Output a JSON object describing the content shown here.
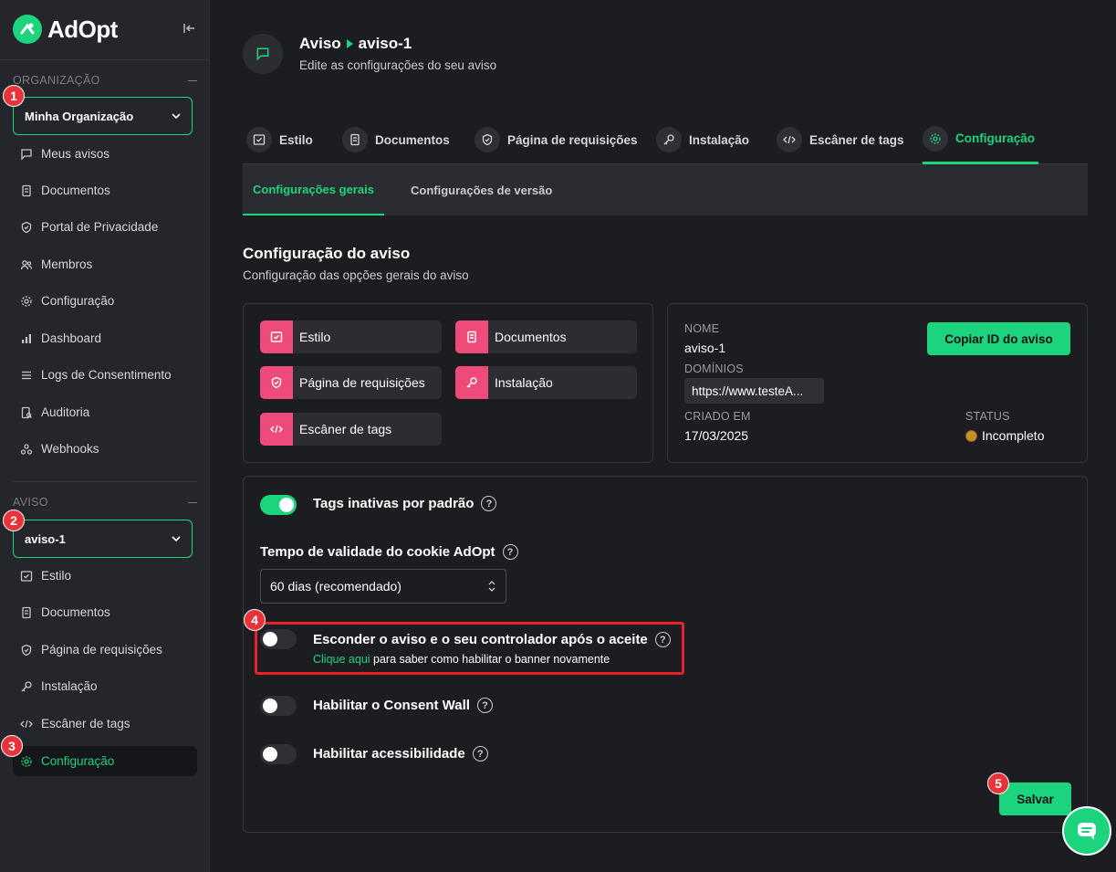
{
  "brand": {
    "name": "AdOpt",
    "color": "#1dd47e"
  },
  "sidebar": {
    "org_section": "ORGANIZAÇÃO",
    "org_select": "Minha Organização",
    "org_items": [
      {
        "label": "Meus avisos",
        "icon": "message-icon"
      },
      {
        "label": "Documentos",
        "icon": "document-icon"
      },
      {
        "label": "Portal de Privacidade",
        "icon": "shield-icon"
      },
      {
        "label": "Membros",
        "icon": "users-icon"
      },
      {
        "label": "Configuração",
        "icon": "gear-icon"
      },
      {
        "label": "Dashboard",
        "icon": "chart-icon"
      },
      {
        "label": "Logs de Consentimento",
        "icon": "list-icon"
      },
      {
        "label": "Auditoria",
        "icon": "audit-icon"
      },
      {
        "label": "Webhooks",
        "icon": "webhook-icon"
      }
    ],
    "notice_section": "AVISO",
    "notice_select": "aviso-1",
    "notice_items": [
      {
        "label": "Estilo",
        "icon": "style-icon"
      },
      {
        "label": "Documentos",
        "icon": "document-icon"
      },
      {
        "label": "Página de requisições",
        "icon": "shield-icon"
      },
      {
        "label": "Instalação",
        "icon": "key-icon"
      },
      {
        "label": "Escâner de tags",
        "icon": "code-icon"
      },
      {
        "label": "Configuração",
        "icon": "gear-icon",
        "active": true
      }
    ]
  },
  "badges": [
    "1",
    "2",
    "3",
    "4",
    "5"
  ],
  "header": {
    "crumb_parent": "Aviso",
    "crumb_current": "aviso-1",
    "subtitle": "Edite as configurações do seu aviso"
  },
  "tabs": [
    {
      "label": "Estilo",
      "icon": "style-icon"
    },
    {
      "label": "Documentos",
      "icon": "document-icon"
    },
    {
      "label": "Página de requisições",
      "icon": "shield-icon"
    },
    {
      "label": "Instalação",
      "icon": "key-icon"
    },
    {
      "label": "Escâner de tags",
      "icon": "code-icon"
    },
    {
      "label": "Configuração",
      "icon": "gear-icon",
      "active": true
    }
  ],
  "subtabs": [
    {
      "label": "Configurações gerais",
      "active": true
    },
    {
      "label": "Configurações de versão"
    }
  ],
  "section": {
    "title": "Configuração do aviso",
    "subtitle": "Configuração das opções gerais do aviso"
  },
  "shortcuts": [
    "Estilo",
    "Documentos",
    "Página de requisições",
    "Instalação",
    "Escâner de tags"
  ],
  "info": {
    "name_label": "NOME",
    "name_value": "aviso-1",
    "domains_label": "DOMÍNIOS",
    "domain_value": "https://www.testeA...",
    "created_label": "CRIADO EM",
    "created_value": "17/03/2025",
    "status_label": "STATUS",
    "status_value": "Incompleto",
    "copy_button": "Copiar ID do aviso"
  },
  "options": {
    "inactive_tags": {
      "label": "Tags inativas por padrão",
      "on": true
    },
    "cookie_validity": {
      "label": "Tempo de validade do cookie AdOpt",
      "value": "60 dias (recomendado)"
    },
    "hide_notice": {
      "label": "Esconder o aviso e o seu controlador após o aceite",
      "on": false,
      "hint_link": "Clique aqui",
      "hint_text": " para saber como habilitar o banner novamente"
    },
    "consent_wall": {
      "label": "Habilitar o Consent Wall",
      "on": false
    },
    "accessibility": {
      "label": "Habilitar acessibilidade",
      "on": false
    },
    "help_glyph": "?"
  },
  "save_button": "Salvar"
}
